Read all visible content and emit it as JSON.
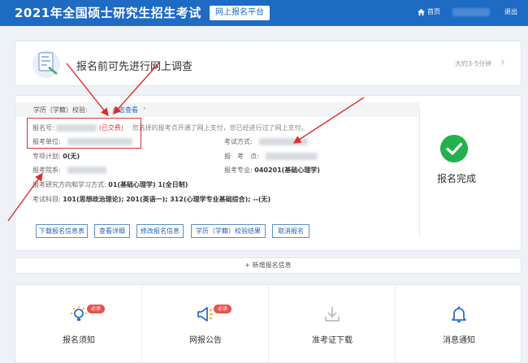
{
  "header": {
    "title": "2021年全国硕士研究生招生考试",
    "platform": "网上报名平台",
    "home": "首页",
    "logout": "退出"
  },
  "survey": {
    "text": "报名前可先进行网上调查",
    "duration": "大约3-5分钟"
  },
  "registration": {
    "verify_label": "学历（学籍）校验:",
    "verify_link": "点击查看",
    "reg_no_label": "报名号:",
    "paid_status": "(已交费)",
    "paid_hint": "您选择的报考点开通了网上支付，您已经进行过了网上支付。",
    "unit_label": "报考单位:",
    "exam_mode_label": "考试方式:",
    "special_plan_label": "专项计划:",
    "special_plan_value": "0(无)",
    "exam_site_label": "报　考　点:",
    "department_label": "报考院系:",
    "major_label": "报考专业:",
    "major_value": "040201(基础心理学)",
    "direction_label": "报考研究方向和学习方式:",
    "direction_value": "01(基础心理学) 1(全日制)",
    "subjects_label": "考试科目:",
    "subjects_value": "101(思想政治理论); 201(英语一); 312(心理学专业基础综合); --(无)",
    "status": "报名完成"
  },
  "actions": [
    "下载报名信息表",
    "查看详细",
    "修改报名信息",
    "学历（学籍）校验结果",
    "取消报名"
  ],
  "add_new": "新增报名信息",
  "cards": [
    {
      "label": "报名须知",
      "icon": "lightbulb-icon",
      "badge": "必读"
    },
    {
      "label": "网报公告",
      "icon": "megaphone-icon",
      "badge": "必读"
    },
    {
      "label": "准考证下载",
      "icon": "download-icon",
      "badge": ""
    },
    {
      "label": "消息通知",
      "icon": "bell-icon",
      "badge": ""
    }
  ],
  "colors": {
    "primary": "#1e6bc4",
    "success": "#22b14c",
    "alert": "#d9302c"
  }
}
